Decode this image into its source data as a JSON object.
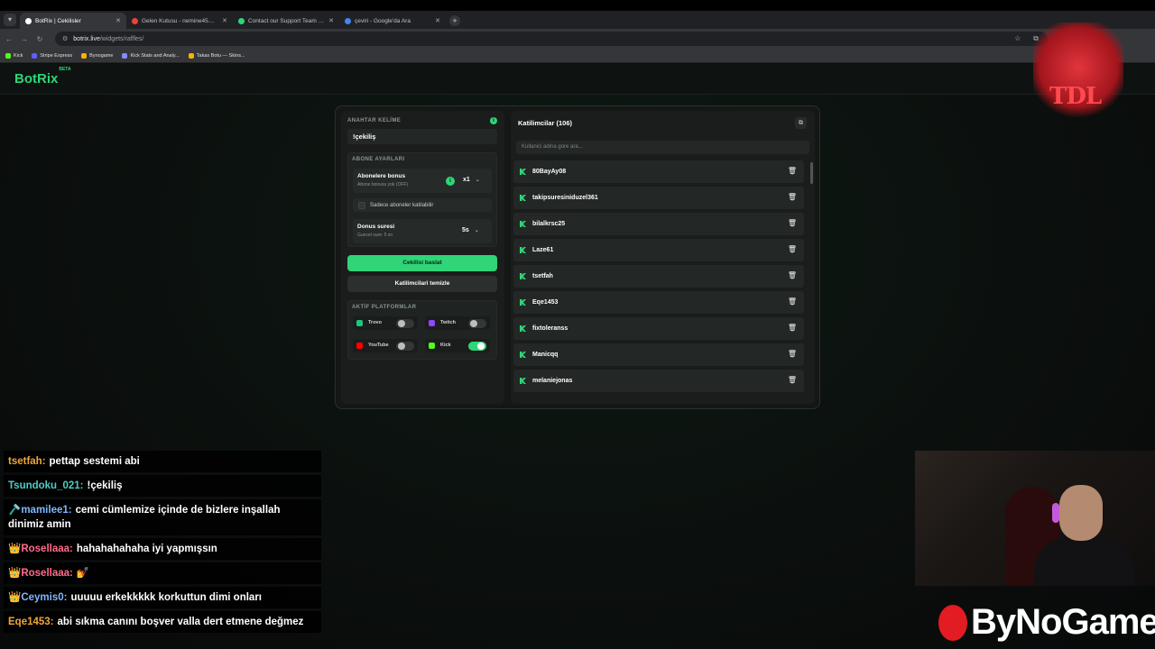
{
  "browser": {
    "tabs": [
      {
        "title": "BotRix | Cekilisler",
        "active": true,
        "favicon_color": "#ffffff"
      },
      {
        "title": "Gelen Kutusu - nemine45@gm",
        "active": false,
        "favicon_color": "#ea4335"
      },
      {
        "title": "Contact our Support Team | Kic",
        "active": false,
        "favicon_color": "#2fd577"
      },
      {
        "title": "çeviri - Google'da Ara",
        "active": false,
        "favicon_color": "#4285f4"
      }
    ],
    "url_host": "botrix.live",
    "url_path": "/widgets/raffles/",
    "bookmarks": [
      {
        "label": "Kick",
        "color": "#53fc18"
      },
      {
        "label": "Stripe Express",
        "color": "#635bff"
      },
      {
        "label": "Bynogame",
        "color": "#f5b301"
      },
      {
        "label": "Kick Stats and Analy...",
        "color": "#8a8aff"
      },
      {
        "label": "Takas Botu — Skins...",
        "color": "#f5b301"
      }
    ]
  },
  "site": {
    "logo": "BotRix",
    "logo_badge": "BETA"
  },
  "raffle": {
    "keyword_label": "ANAHTAR KELİME",
    "keyword_value": "!çekiliş",
    "sub_settings_label": "ABONE AYARLARI",
    "sub_bonus_title": "Abonelere bonus",
    "sub_bonus_sub": "Abone bonusu yok (OFF)",
    "sub_bonus_multiplier": "x1",
    "subs_only_label": "Sadece aboneler katilabilir",
    "bonus_time_title": "Donus suresi",
    "bonus_time_sub": "Guncel sure: 5 sn",
    "bonus_time_value": "5s",
    "start_button": "Cekilisi baslat",
    "clear_button": "Katilimcilari temizle",
    "platforms_label": "AKTİF PLATFORMLAR",
    "platforms": [
      {
        "name": "Trovo",
        "enabled": false,
        "color": "#1ec47a"
      },
      {
        "name": "Twitch",
        "enabled": false,
        "color": "#9146ff"
      },
      {
        "name": "YouTube",
        "enabled": false,
        "color": "#ff0000"
      },
      {
        "name": "Kick",
        "enabled": true,
        "color": "#53fc18"
      }
    ]
  },
  "participants": {
    "title": "Katilimcilar (106)",
    "search_placeholder": "Kullanici adina gore ara...",
    "names": [
      "80BayAy08",
      "takipsuresiniduzel361",
      "bilalkrsc25",
      "Laze61",
      "tsetfah",
      "Eqe1453",
      "fixtoleranss",
      "Manicqq",
      "melaniejonas"
    ]
  },
  "chat": [
    {
      "user": "tsetfah:",
      "text": "pettap sestemi abi",
      "color": "#f0a63a",
      "badge": ""
    },
    {
      "user": "Tsundoku_021:",
      "text": "!çekiliş",
      "color": "#4ecdc4",
      "badge": ""
    },
    {
      "user": "mamilee1:",
      "text": "cemi cümlemize içinde de bizlere inşallah dinimiz amin",
      "color": "#7fb7ff",
      "badge": "🪒"
    },
    {
      "user": "Rosellaaa:",
      "text": "hahahahahaha iyi yapmışsın",
      "color": "#ff6b8b",
      "badge": "👑"
    },
    {
      "user": "Rosellaaa:",
      "text": "💅",
      "color": "#ff6b8b",
      "badge": "👑"
    },
    {
      "user": "Ceymis0:",
      "text": "uuuuu erkekkkkk korkuttun dimi onları",
      "color": "#7fb7ff",
      "badge": "👑"
    },
    {
      "user": "Eqe1453:",
      "text": "abi sıkma canını boşver valla dert etmene değmez",
      "color": "#f0a63a",
      "badge": ""
    }
  ],
  "overlay": {
    "brand": "ByNoGame",
    "team": "TDL"
  }
}
